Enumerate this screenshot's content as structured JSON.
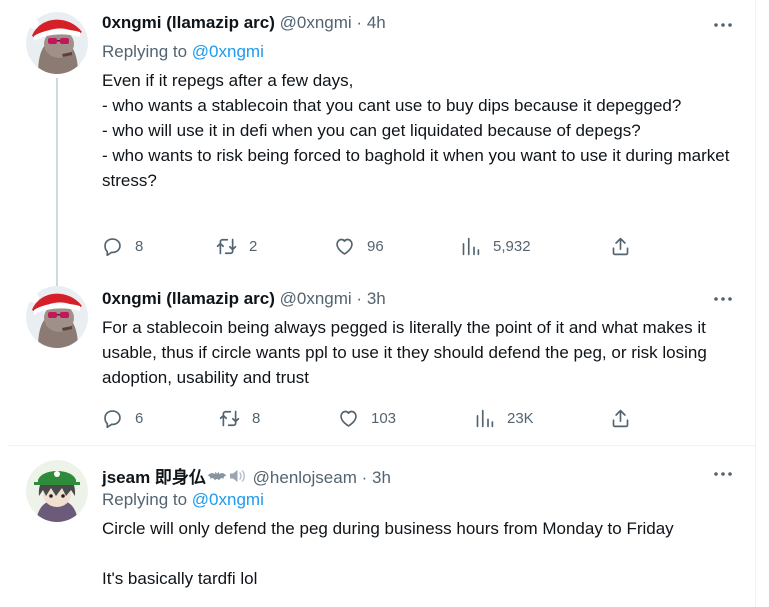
{
  "tweets": [
    {
      "name": "0xngmi (llamazip arc)",
      "handle": "@0xngmi",
      "time": "4h",
      "replying_label": "Replying to",
      "replying_to": "@0xngmi",
      "lines": [
        "Even if it repegs after a few days,",
        "- who wants a stablecoin that you cant use to buy dips because it depegged?",
        "- who will use it in defi when you can get liquidated because of depegs?",
        "- who wants to risk being forced to baghold it when you want to use it during market stress?"
      ],
      "replies": "8",
      "retweets": "2",
      "likes": "96",
      "views": "5,932"
    },
    {
      "name": "0xngmi (llamazip arc)",
      "handle": "@0xngmi",
      "time": "3h",
      "lines": [
        "For a stablecoin being always pegged is literally the point of it and what makes it usable, thus if circle wants ppl to use it they should defend the peg, or risk losing adoption, usability and trust"
      ],
      "replies": "6",
      "retweets": "8",
      "likes": "103",
      "views": "23K"
    },
    {
      "name": "jseam 即身仏",
      "handle": "@henlojseam",
      "time": "3h",
      "replying_label": "Replying to",
      "replying_to": "@0xngmi",
      "lines": [
        "Circle will only defend the peg during business hours from Monday to Friday",
        "It's basically tardfi lol"
      ]
    }
  ],
  "separator": "·",
  "colors": {
    "accent": "#1d9bf0",
    "muted": "#536471",
    "text": "#0f1419",
    "santa_hat": "#d61f26"
  },
  "icons": [
    "more-icon",
    "reply-icon",
    "retweet-icon",
    "like-icon",
    "views-icon",
    "share-icon",
    "bat-emoji-icon",
    "speaker-emoji-icon"
  ]
}
